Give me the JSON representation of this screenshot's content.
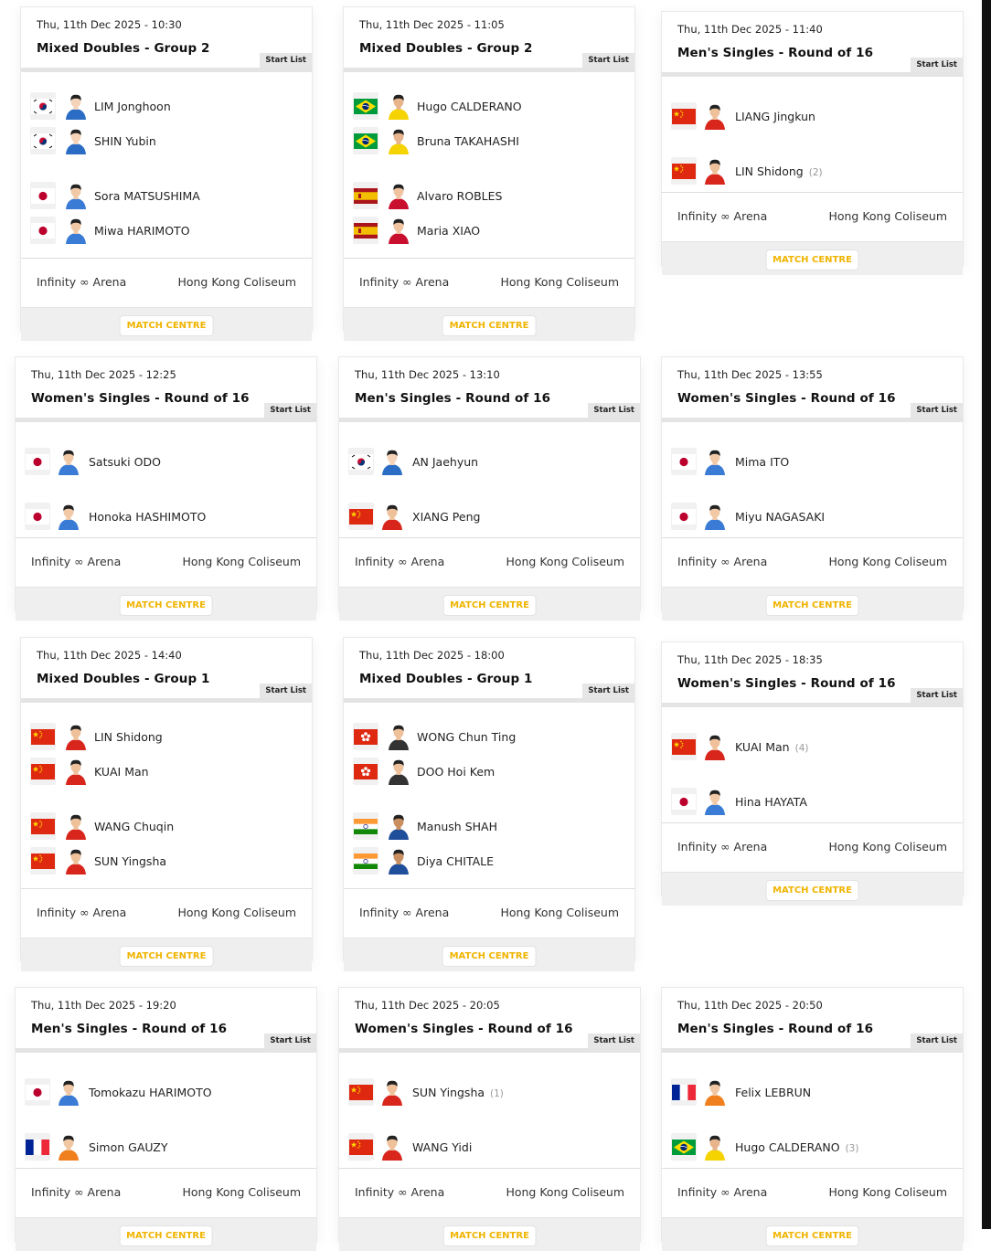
{
  "venue_left": "Infinity ∞ Arena",
  "venue_right": "Hong Kong Coliseum",
  "start_list_label": "Start List",
  "match_centre_label": "MATCH CENTRE",
  "colors": {
    "accent": "#f0b400",
    "footer_bg": "#efefef"
  },
  "matches": [
    {
      "date": "Thu, 11th Dec 2025 - 10:30",
      "title": "Mixed Doubles - Group 2",
      "players": [
        {
          "name": "LIM Jonghoon",
          "flag": "korea",
          "seed": ""
        },
        {
          "name": "SHIN Yubin",
          "flag": "korea",
          "seed": ""
        },
        {
          "name": "Sora MATSUSHIMA",
          "flag": "japan",
          "seed": ""
        },
        {
          "name": "Miwa HARIMOTO",
          "flag": "japan",
          "seed": ""
        }
      ]
    },
    {
      "date": "Thu, 11th Dec 2025 - 11:05",
      "title": "Mixed Doubles - Group 2",
      "players": [
        {
          "name": "Hugo CALDERANO",
          "flag": "brazil",
          "seed": ""
        },
        {
          "name": "Bruna TAKAHASHI",
          "flag": "brazil",
          "seed": ""
        },
        {
          "name": "Alvaro ROBLES",
          "flag": "spain",
          "seed": ""
        },
        {
          "name": "Maria XIAO",
          "flag": "spain",
          "seed": ""
        }
      ]
    },
    {
      "date": "Thu, 11th Dec 2025 - 11:40",
      "title": "Men's Singles - Round of 16",
      "players": [
        {
          "name": "LIANG Jingkun",
          "flag": "china",
          "seed": ""
        },
        {
          "name": "LIN Shidong",
          "flag": "china",
          "seed": "(2)"
        }
      ]
    },
    {
      "date": "Thu, 11th Dec 2025 - 12:25",
      "title": "Women's Singles - Round of 16",
      "players": [
        {
          "name": "Satsuki ODO",
          "flag": "japan",
          "seed": ""
        },
        {
          "name": "Honoka HASHIMOTO",
          "flag": "japan",
          "seed": ""
        }
      ]
    },
    {
      "date": "Thu, 11th Dec 2025 - 13:10",
      "title": "Men's Singles - Round of 16",
      "players": [
        {
          "name": "AN Jaehyun",
          "flag": "korea",
          "seed": ""
        },
        {
          "name": "XIANG Peng",
          "flag": "china",
          "seed": ""
        }
      ]
    },
    {
      "date": "Thu, 11th Dec 2025 - 13:55",
      "title": "Women's Singles - Round of 16",
      "players": [
        {
          "name": "Mima ITO",
          "flag": "japan",
          "seed": ""
        },
        {
          "name": "Miyu NAGASAKI",
          "flag": "japan",
          "seed": ""
        }
      ]
    },
    {
      "date": "Thu, 11th Dec 2025 - 14:40",
      "title": "Mixed Doubles - Group 1",
      "players": [
        {
          "name": "LIN Shidong",
          "flag": "china",
          "seed": ""
        },
        {
          "name": "KUAI Man",
          "flag": "china",
          "seed": ""
        },
        {
          "name": "WANG Chuqin",
          "flag": "china",
          "seed": ""
        },
        {
          "name": "SUN Yingsha",
          "flag": "china",
          "seed": ""
        }
      ]
    },
    {
      "date": "Thu, 11th Dec 2025 - 18:00",
      "title": "Mixed Doubles - Group 1",
      "players": [
        {
          "name": "WONG Chun Ting",
          "flag": "hongkong",
          "seed": ""
        },
        {
          "name": "DOO Hoi Kem",
          "flag": "hongkong",
          "seed": ""
        },
        {
          "name": "Manush SHAH",
          "flag": "india",
          "seed": ""
        },
        {
          "name": "Diya CHITALE",
          "flag": "india",
          "seed": ""
        }
      ]
    },
    {
      "date": "Thu, 11th Dec 2025 - 18:35",
      "title": "Women's Singles - Round of 16",
      "players": [
        {
          "name": "KUAI Man",
          "flag": "china",
          "seed": "(4)"
        },
        {
          "name": "Hina HAYATA",
          "flag": "japan",
          "seed": ""
        }
      ]
    },
    {
      "date": "Thu, 11th Dec 2025 - 19:20",
      "title": "Men's Singles - Round of 16",
      "players": [
        {
          "name": "Tomokazu HARIMOTO",
          "flag": "japan",
          "seed": ""
        },
        {
          "name": "Simon GAUZY",
          "flag": "france",
          "seed": ""
        }
      ]
    },
    {
      "date": "Thu, 11th Dec 2025 - 20:05",
      "title": "Women's Singles - Round of 16",
      "players": [
        {
          "name": "SUN Yingsha",
          "flag": "china",
          "seed": "(1)"
        },
        {
          "name": "WANG Yidi",
          "flag": "china",
          "seed": ""
        }
      ]
    },
    {
      "date": "Thu, 11th Dec 2025 - 20:50",
      "title": "Men's Singles - Round of 16",
      "players": [
        {
          "name": "Felix LEBRUN",
          "flag": "france",
          "seed": ""
        },
        {
          "name": "Hugo CALDERANO",
          "flag": "brazil",
          "seed": "(3)"
        }
      ]
    }
  ]
}
